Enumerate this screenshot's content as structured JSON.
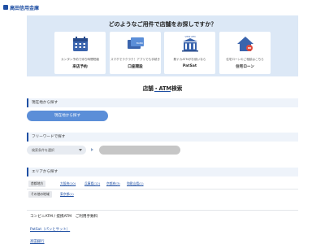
{
  "header": {
    "logo_text": "高田信用金庫"
  },
  "hero": {
    "question": "どのようなご用件で店舗をお探しですか？",
    "cards": [
      {
        "icon": "calendar-icon",
        "description": "カンタン予約で待ち時間短縮",
        "title": "来店予約"
      },
      {
        "icon": "card-icon",
        "card_text": "BANK",
        "description": "スマホでラクラク！アプリでも手続き",
        "title": "口座開設"
      },
      {
        "icon": "bank-icon",
        "building_text": "VIEW ATM",
        "description": "駅ナカATMがお使いなら",
        "title": "PatSat"
      },
      {
        "icon": "house-icon",
        "description": "住宅ローンのご相談はこちら",
        "title": "住宅ローン"
      }
    ]
  },
  "section_title": "店舗・ATM検索",
  "current_location": {
    "label": "現在地から探す",
    "button": "現在地から探す"
  },
  "freeword": {
    "label": "フリーワードで探す",
    "select_value": "検索条件を選択"
  },
  "area": {
    "label": "エリアから探す",
    "row1": {
      "chip": "首都地方",
      "links": [
        "大阪府(10)",
        "兵庫県(12)",
        "京都府(3)",
        "和歌山県(1)"
      ]
    },
    "row2": {
      "chip": "その他の地域",
      "links": [
        "東京都(1)"
      ]
    }
  },
  "convenience": {
    "label": "コンビニATM / 提携ATM　ご利用手数料",
    "link": "PatSat（パッとサット）"
  },
  "footer_link": "高田銀行"
}
